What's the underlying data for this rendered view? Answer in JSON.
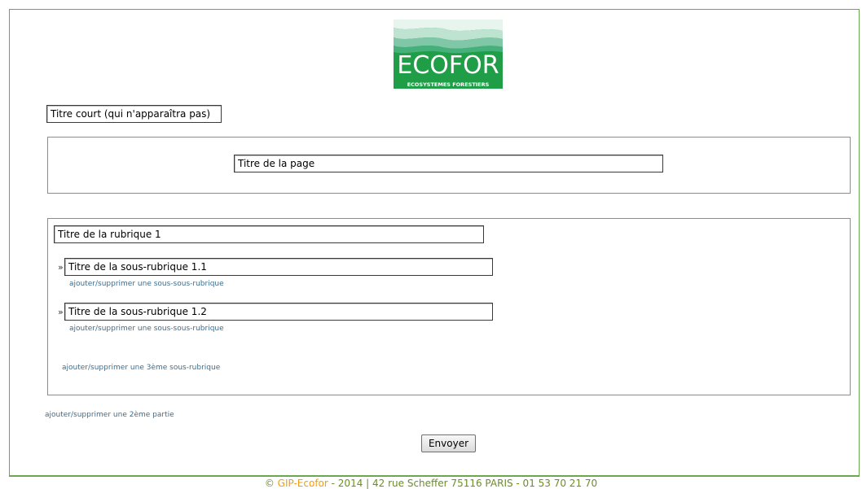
{
  "logo": {
    "title": "ECOFOR",
    "subtitle": "ECOSYSTEMES FORESTIERS",
    "colors": [
      "#1f9e47",
      "#7fc7a6",
      "#bfe3d1"
    ]
  },
  "form": {
    "short_title": {
      "value": "Titre court (qui n'apparaîtra pas)"
    },
    "page_title": {
      "value": "Titre de la page"
    },
    "section1": {
      "title": {
        "value": "Titre de la rubrique 1"
      },
      "subsections": [
        {
          "bullet": "»",
          "value": "Titre de la sous-rubrique 1.1",
          "link": "ajouter/supprimer une sous-sous-rubrique"
        },
        {
          "bullet": "»",
          "value": "Titre de la sous-rubrique 1.2",
          "link": "ajouter/supprimer une sous-sous-rubrique"
        }
      ],
      "add_third_link": "ajouter/supprimer une 3ème sous-rubrique"
    },
    "add_second_part_link": "ajouter/supprimer une 2ème partie",
    "submit_label": "Envoyer"
  },
  "footer": {
    "copyright": "©",
    "brand": "GIP-Ecofor",
    "rest": "- 2014 | 42 rue Scheffer 75116 PARIS - 01 53 70 21 70",
    "colors": {
      "text": "#6b8e23",
      "brand": "#f39c12"
    }
  },
  "colors": {
    "frame": "#6aa84f",
    "link": "#3d6d8e"
  }
}
